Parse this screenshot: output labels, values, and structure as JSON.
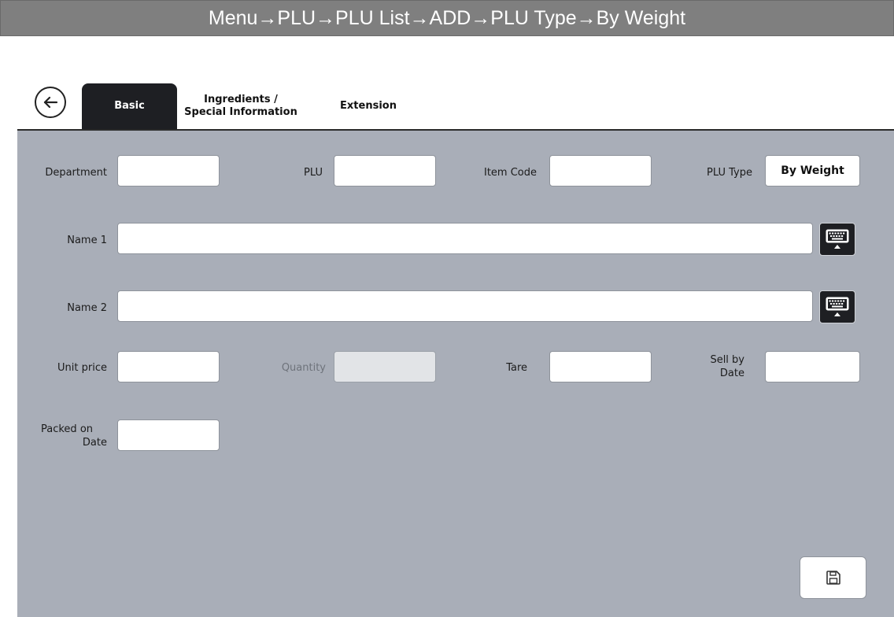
{
  "breadcrumb": "Menu→PLU→PLU List→ADD→PLU Type→By Weight",
  "tabs": {
    "basic": "Basic",
    "ingredients_line1": "Ingredients /",
    "ingredients_line2": "Special Information",
    "extension": "Extension"
  },
  "form": {
    "department_label": "Department",
    "department_value": "",
    "plu_label": "PLU",
    "plu_value": "",
    "item_code_label": "Item Code",
    "item_code_value": "",
    "plu_type_label": "PLU Type",
    "plu_type_value": "By Weight",
    "name1_label": "Name 1",
    "name1_value": "",
    "name2_label": "Name 2",
    "name2_value": "",
    "unit_price_label": "Unit price",
    "unit_price_value": "",
    "quantity_label": "Quantity",
    "quantity_value": "",
    "tare_label": "Tare",
    "tare_value": "",
    "sell_by_line1": "Sell by",
    "sell_by_line2": "Date",
    "sell_by_value": "",
    "packed_on_line1": "Packed on",
    "packed_on_line2": "Date",
    "packed_on_value": ""
  },
  "icons": {
    "back": "back-arrow-icon",
    "keyboard": "keyboard-icon",
    "save": "floppy-disk-icon"
  },
  "colors": {
    "panel": "#a9aeb8",
    "active_tab": "#1e1f23",
    "breadcrumb_bar": "#7f7f7f"
  }
}
